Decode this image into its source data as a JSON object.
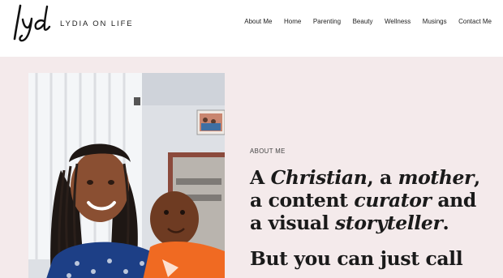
{
  "header": {
    "logo_mark": "lyd",
    "site_name": "LYDIA ON LIFE"
  },
  "nav": {
    "items": [
      {
        "label": "About Me"
      },
      {
        "label": "Home"
      },
      {
        "label": "Parenting"
      },
      {
        "label": "Beauty"
      },
      {
        "label": "Wellness"
      },
      {
        "label": "Musings"
      },
      {
        "label": "Contact Me"
      }
    ]
  },
  "hero": {
    "eyebrow": "ABOUT ME",
    "tagline": {
      "a": "A ",
      "christian": "Christian",
      "comma_a": ", a ",
      "mother": "mother",
      "comma": ",",
      "line2_a": "a content ",
      "curator": "curator",
      "line2_b": " and",
      "line3_a": "a visual ",
      "storyteller": "storyteller",
      "period": "."
    },
    "subline": "But you can just call"
  }
}
